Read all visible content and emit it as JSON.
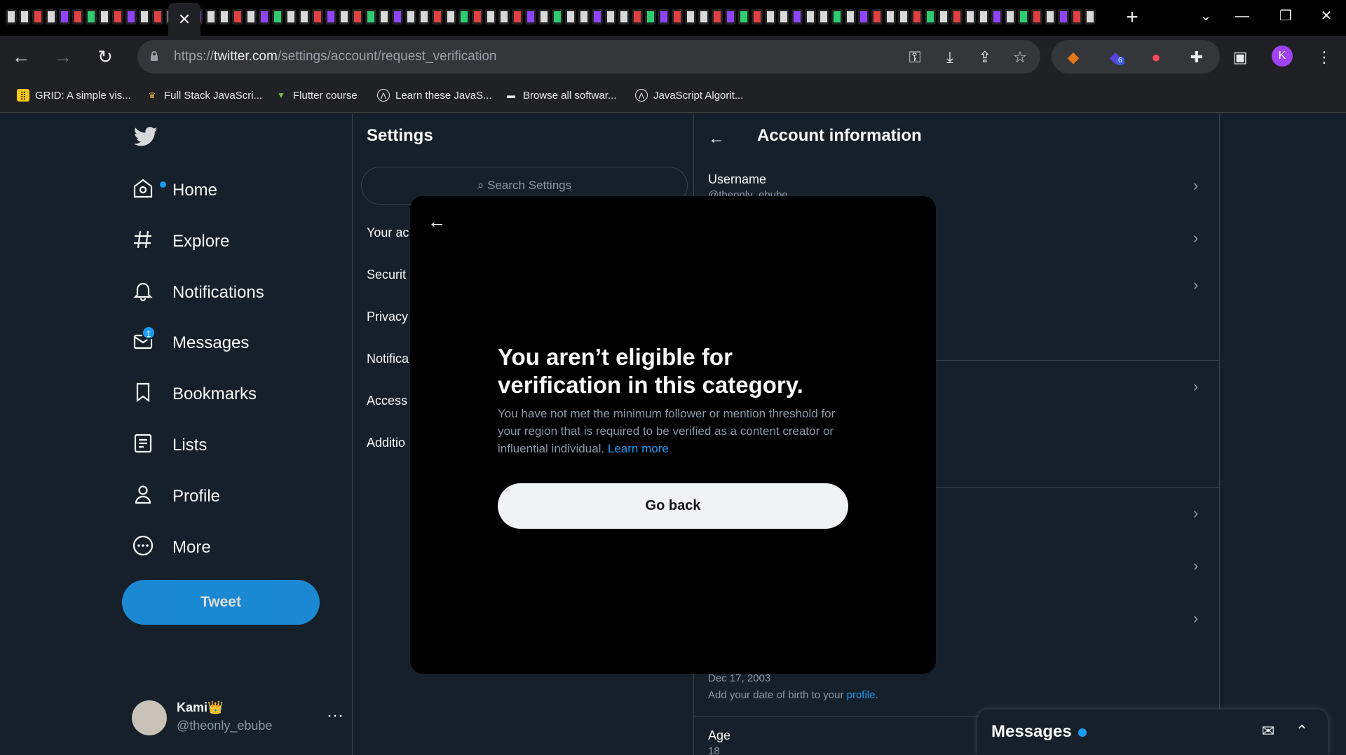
{
  "browser": {
    "url_prefix": "https://",
    "url_domain": "twitter.com",
    "url_path": "/settings/account/request_verification",
    "profile_initial": "K",
    "extension_badge": "6",
    "bookmarks": [
      {
        "label": "GRID: A simple vis..."
      },
      {
        "label": "Full Stack JavaScri..."
      },
      {
        "label": "Flutter course"
      },
      {
        "label": "Learn these JavaS..."
      },
      {
        "label": "Browse all softwar..."
      },
      {
        "label": "JavaScript Algorit..."
      }
    ]
  },
  "sidebar": {
    "items": [
      {
        "label": "Home",
        "icon": "home-icon"
      },
      {
        "label": "Explore",
        "icon": "hashtag-icon"
      },
      {
        "label": "Notifications",
        "icon": "bell-icon"
      },
      {
        "label": "Messages",
        "icon": "envelope-icon",
        "badge": "1"
      },
      {
        "label": "Bookmarks",
        "icon": "bookmark-icon"
      },
      {
        "label": "Lists",
        "icon": "list-icon"
      },
      {
        "label": "Profile",
        "icon": "person-icon"
      },
      {
        "label": "More",
        "icon": "more-circle-icon"
      }
    ],
    "tweet_label": "Tweet",
    "user": {
      "name": "Kami👑",
      "handle": "@theonly_ebube"
    }
  },
  "settings": {
    "title": "Settings",
    "search_placeholder": "Search Settings",
    "items": [
      "Your ac",
      "Securit",
      "Privacy",
      "Notifica",
      "Access",
      "Additio"
    ]
  },
  "account": {
    "title": "Account information",
    "username_label": "Username",
    "username_value": "@theonly_ebube",
    "birth_date": "Dec 17, 2003",
    "birth_note": "Add your date of birth to your ",
    "birth_note_link": "profile",
    "birth_note_end": ".",
    "age_label": "Age",
    "age_value": "18"
  },
  "modal": {
    "title": "You aren’t eligible for verification in this category.",
    "body": "You have not met the minimum follower or mention threshold for your region that is required to be verified as a content creator or influential individual. ",
    "link": "Learn more",
    "button": "Go back"
  },
  "messages_drawer": {
    "title": "Messages"
  },
  "colors": {
    "accent": "#1d9bf0",
    "background": "#15202b",
    "modal": "#000000"
  }
}
